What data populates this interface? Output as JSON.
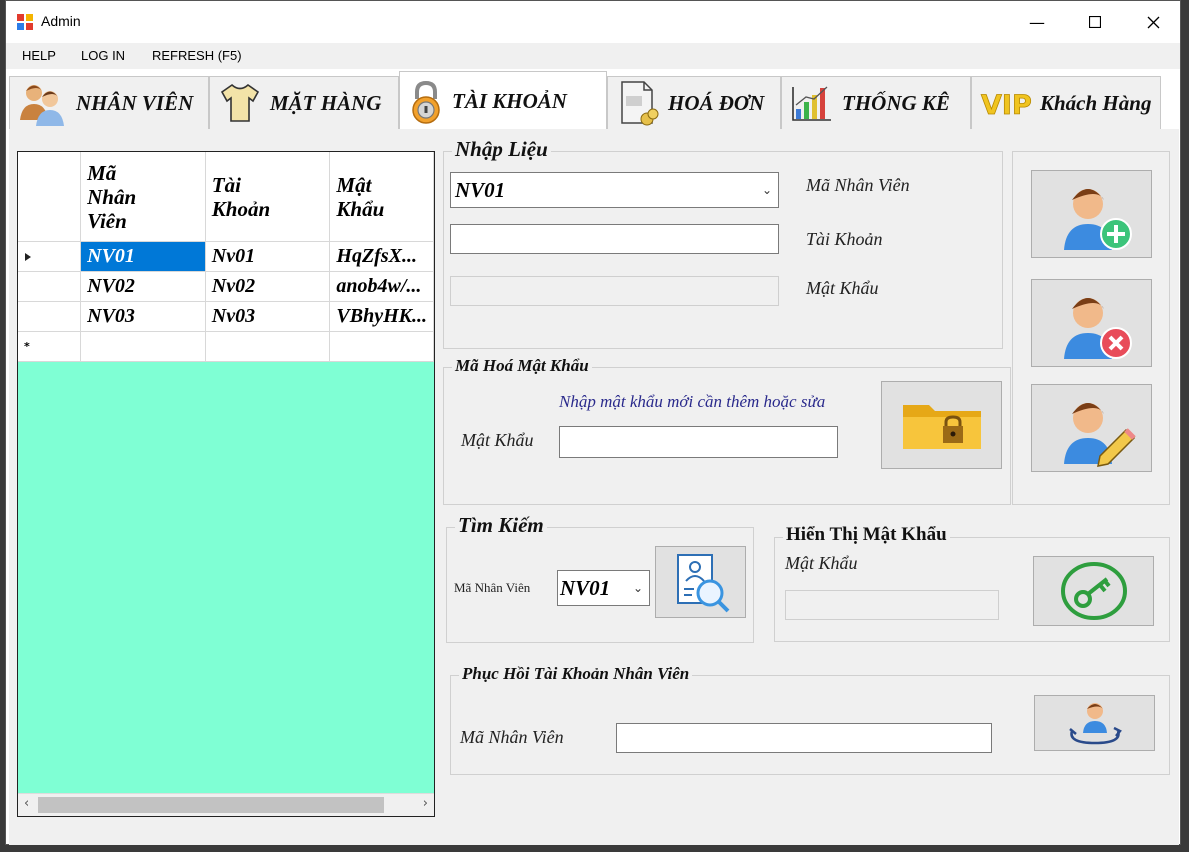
{
  "window": {
    "title": "Admin"
  },
  "menu": {
    "help": "HELP",
    "login": "LOG IN",
    "refresh": "REFRESH (F5)"
  },
  "tabs": [
    {
      "label": "NHÂN VIÊN"
    },
    {
      "label": "MẶT HÀNG"
    },
    {
      "label": "TÀI KHOẢN"
    },
    {
      "label": "HOÁ ĐƠN"
    },
    {
      "label": "THỐNG KÊ"
    },
    {
      "label": "Khách Hàng"
    }
  ],
  "grid": {
    "columns": [
      "Mã Nhân Viên",
      "Tài Khoản",
      "Mật Khẩu"
    ],
    "rows": [
      [
        "NV01",
        "Nv01",
        "HqZfsX..."
      ],
      [
        "NV02",
        "Nv02",
        "anob4w/..."
      ],
      [
        "NV03",
        "Nv03",
        "VBhyHK..."
      ]
    ],
    "new_row_marker": "*",
    "background": "#7fffd4"
  },
  "nhap_lieu": {
    "title": "Nhập Liệu",
    "ma_nv_value": "NV01",
    "ma_nv_label": "Mã Nhân Viên",
    "tai_khoan_label": "Tài Khoản",
    "mat_khau_label": "Mật Khẩu"
  },
  "ma_hoa": {
    "title": "Mã Hoá Mật Khẩu",
    "hint": "Nhập mật khẩu mới cần thêm hoặc sửa",
    "mat_khau_label": "Mật Khẩu"
  },
  "tim_kiem": {
    "title": "Tìm Kiếm",
    "ma_nv_label": "Mã Nhân Viên",
    "ma_nv_value": "NV01"
  },
  "hien_thi": {
    "title": "Hiển Thị Mật Khẩu",
    "mat_khau_label": "Mật Khẩu"
  },
  "phuc_hoi": {
    "title": "Phục Hồi Tài Khoản Nhân Viên",
    "ma_nv_label": "Mã Nhân Viên"
  },
  "icons": {
    "add": "add-user-icon",
    "delete": "delete-user-icon",
    "edit": "edit-user-icon",
    "encrypt": "locked-folder-icon",
    "search": "search-user-icon",
    "show_password": "key-icon",
    "restore": "restore-user-icon"
  },
  "colors": {
    "selection": "#0078d7",
    "grid_bg": "#7fffd4",
    "key": "#2e9e3e",
    "add": "#3cc47a",
    "delete": "#e84c5a"
  }
}
